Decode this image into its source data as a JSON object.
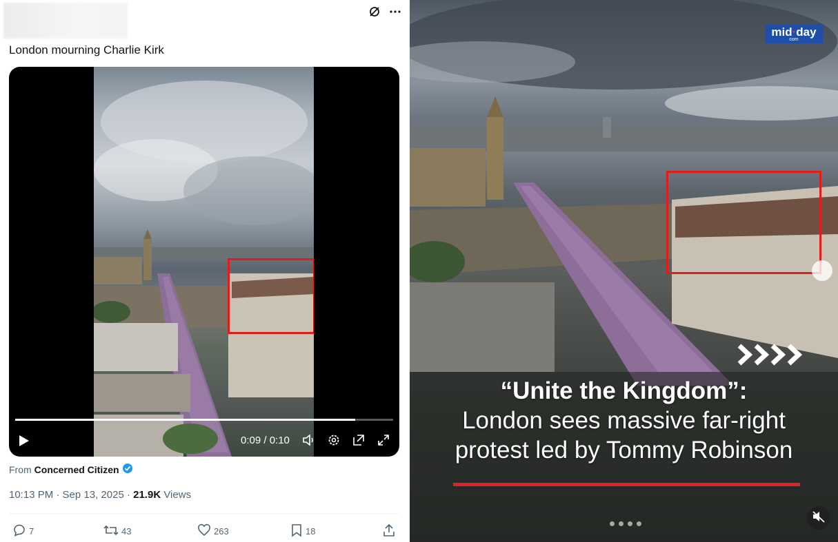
{
  "tweet": {
    "text": "London mourning Charlie Kirk",
    "video": {
      "time": "0:09 / 0:10",
      "progress": 0.9
    },
    "from_prefix": "From",
    "from_name": "Concerned Citizen",
    "timestamp": "10:13 PM · Sep 13, 2025 ·",
    "views_count": "21.9K",
    "views_label": "Views",
    "actions": {
      "replies": "7",
      "reposts": "43",
      "likes": "263",
      "bookmarks": "18"
    }
  },
  "panel": {
    "logo_main_a": "mid",
    "logo_main_dot": "·",
    "logo_main_b": "day",
    "logo_sub": "com",
    "headline_1": "“Unite the Kingdom”:",
    "headline_2": "London sees massive far-right",
    "headline_3": "protest led by Tommy Robinson"
  },
  "colors": {
    "highlight_box": "#e21b1b",
    "verified": "#1d9bf0",
    "accent_red": "#e02424"
  }
}
